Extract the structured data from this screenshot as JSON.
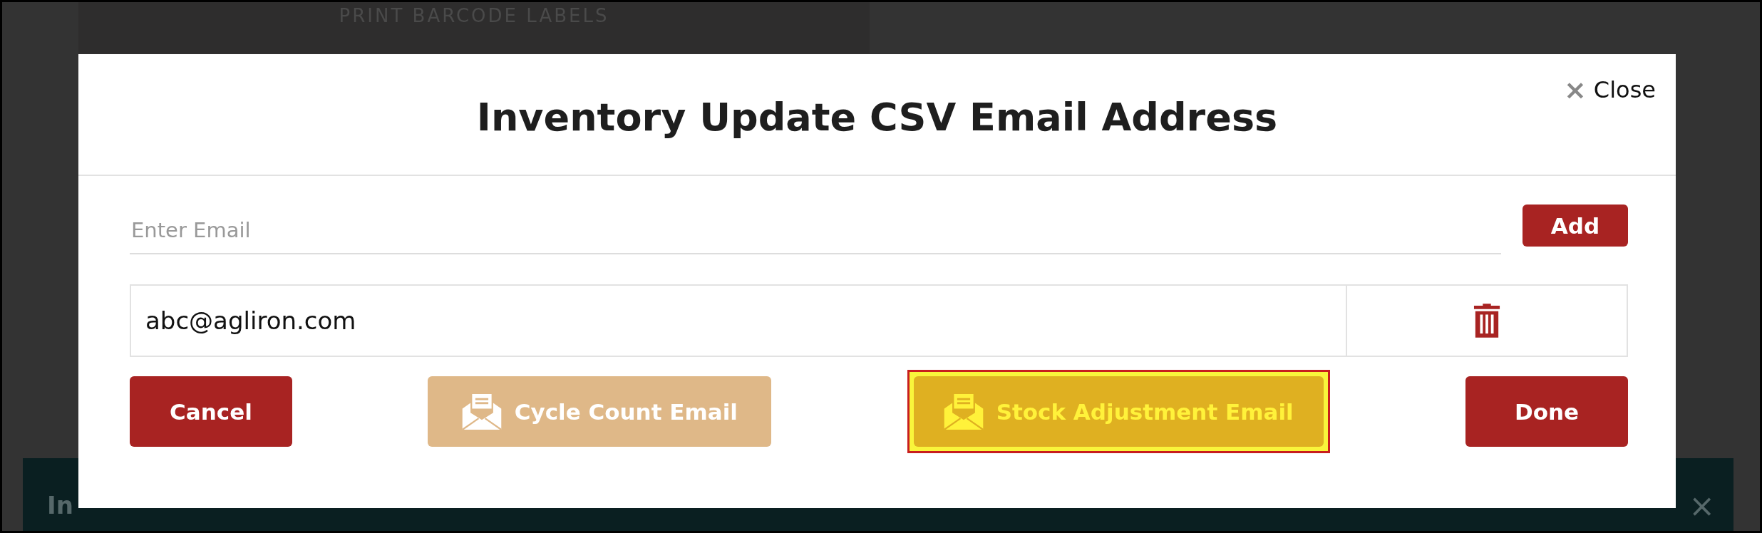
{
  "background": {
    "header_text": "PRINT BARCODE LABELS",
    "banner_text": "In",
    "banner_close": "×"
  },
  "modal": {
    "title": "Inventory Update CSV Email Address",
    "close": {
      "icon": "×",
      "label": "Close"
    },
    "email_field": {
      "placeholder": "Enter Email"
    },
    "add_button": "Add",
    "emails": [
      {
        "address": "abc@agliron.com"
      }
    ],
    "buttons": [
      {
        "label": "Cancel",
        "kind": "primary",
        "highlighted": false
      },
      {
        "label": "Cycle Count Email",
        "kind": "email",
        "highlighted": false
      },
      {
        "label": "Stock Adjustment Email",
        "kind": "email",
        "highlighted": true
      },
      {
        "label": "Done",
        "kind": "primary",
        "highlighted": false
      }
    ]
  }
}
